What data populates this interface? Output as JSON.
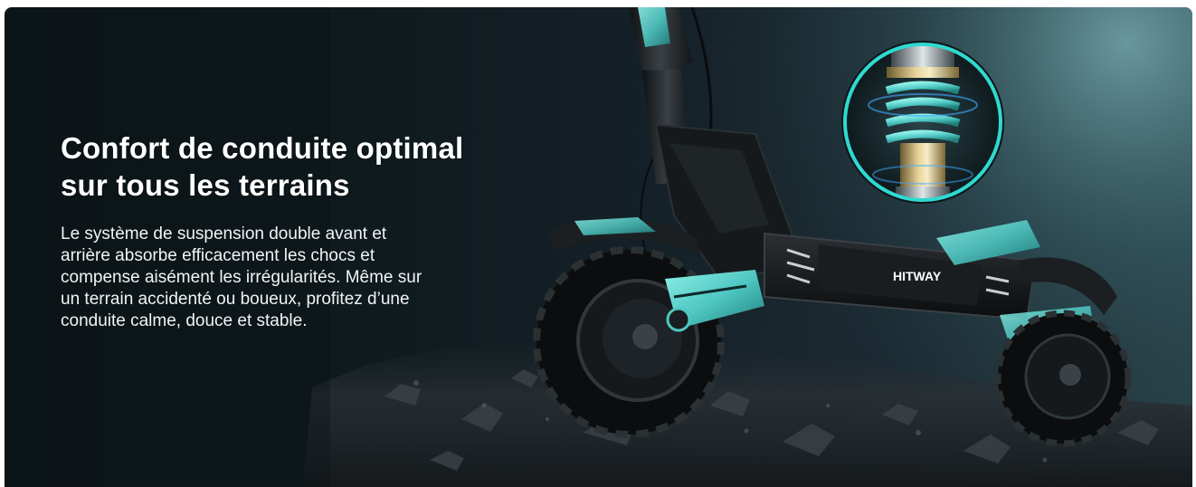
{
  "feature": {
    "headline_lines": [
      "Confort de conduite optimal",
      "sur tous les terrains"
    ],
    "body_lines": [
      "Le système de suspension double avant et",
      "arrière absorbe efficacement les chocs et",
      "compense aisément les irrégularités. Même sur",
      "un terrain accidenté ou boueux, profitez d’une",
      "conduite calme, douce et stable."
    ]
  },
  "product": {
    "brand_logo": "HITWAY",
    "image": "electric-scooter-suspension",
    "inset": "shock-absorber-spring"
  },
  "colors": {
    "background_dark": "#0c1417",
    "accent_teal": "#4fc7c2",
    "ring_teal": "#2fd9d0",
    "text": "#ffffff"
  }
}
